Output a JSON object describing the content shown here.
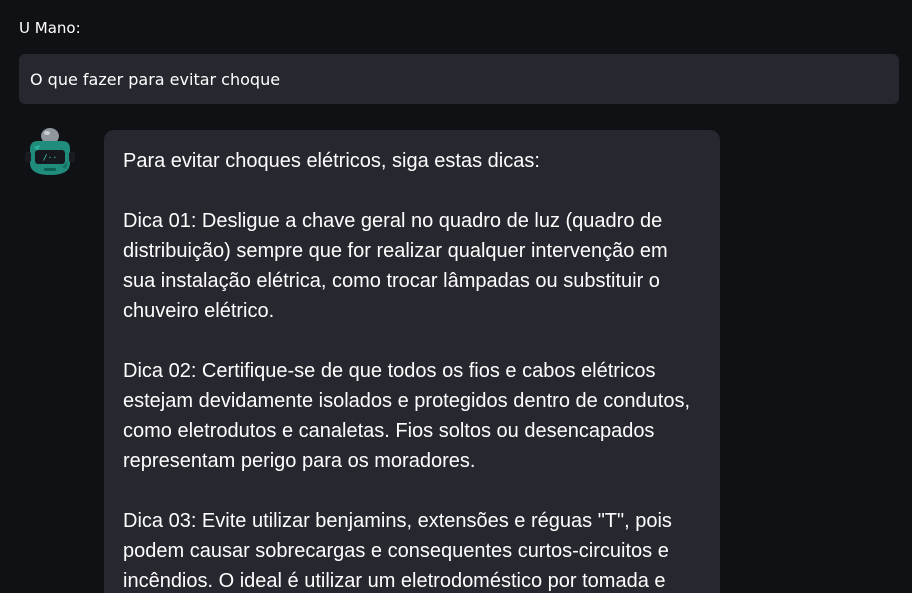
{
  "chat": {
    "user": {
      "name": "U Mano:",
      "message": "O que fazer para evitar choque"
    },
    "assistant": {
      "avatar_icon": "robot-icon",
      "intro": "Para evitar choques elétricos, siga estas dicas:",
      "tips": [
        "Dica 01: Desligue a chave geral no quadro de luz (quadro de distribuição) sempre que for realizar qualquer intervenção em sua instalação elétrica, como trocar lâmpadas ou substituir o chuveiro elétrico.",
        "Dica 02: Certifique-se de que todos os fios e cabos elétricos estejam devidamente isolados e protegidos dentro de condutos, como eletrodutos e canaletas. Fios soltos ou desencapados representam perigo para os moradores.",
        "Dica 03: Evite utilizar benjamins, extensões e réguas \"T\", pois podem causar sobrecargas e consequentes curtos-circuitos e incêndios. O ideal é utilizar um eletrodoméstico por tomada e"
      ]
    }
  },
  "colors": {
    "background": "#101114",
    "bubble": "#26272f",
    "text": "#ffffff",
    "avatar_teal": "#1f8c7c"
  }
}
